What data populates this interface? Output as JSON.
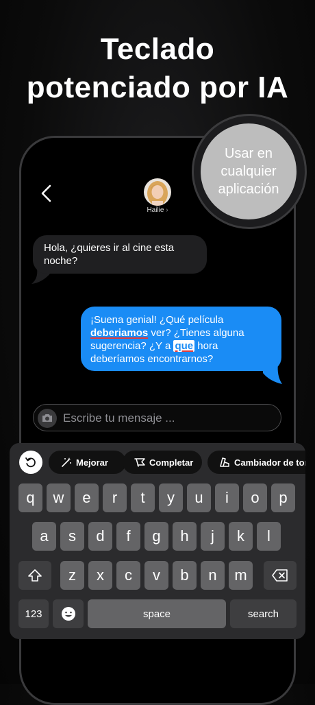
{
  "headline": {
    "line1": "Teclado",
    "line2": "potenciado por IA"
  },
  "badge": {
    "line1": "Usar en",
    "line2": "cualquier",
    "line3": "aplicación"
  },
  "contact": {
    "name": "Hailie"
  },
  "messages": {
    "incoming": "Hola, ¿quieres ir al cine esta noche?",
    "outgoing": {
      "p1": "¡Suena genial! ¿Qué película ",
      "h1": "deberiamos",
      "p2": " ver? ¿Tienes alguna sugerencia? ¿Y a ",
      "h2": "que",
      "p3": " hora deberíamos encontrarnos?"
    }
  },
  "compose": {
    "placeholder": "Escribe tu mensaje ..."
  },
  "toolbar": {
    "improve": "Mejorar",
    "complete": "Completar",
    "tone": "Cambiador de tono"
  },
  "keys": {
    "row1": [
      "q",
      "w",
      "e",
      "r",
      "t",
      "y",
      "u",
      "i",
      "o",
      "p"
    ],
    "row2": [
      "a",
      "s",
      "d",
      "f",
      "g",
      "h",
      "j",
      "k",
      "l"
    ],
    "row3": [
      "z",
      "x",
      "c",
      "v",
      "b",
      "n",
      "m"
    ],
    "numbers": "123",
    "space": "space",
    "search": "search"
  },
  "colors": {
    "outgoing_bubble": "#1a8cf5",
    "incoming_bubble": "#1f1f21",
    "badge": "#bdbdbd",
    "error_underline": "#e23b3b"
  }
}
